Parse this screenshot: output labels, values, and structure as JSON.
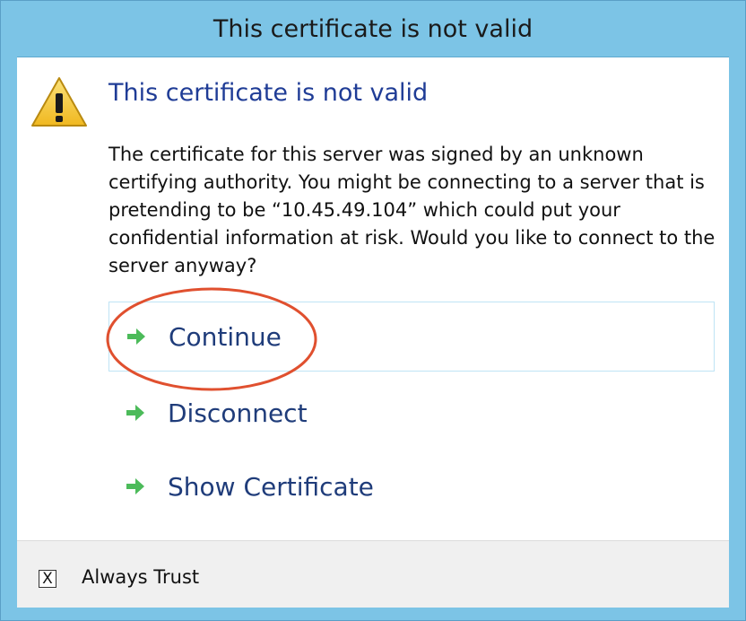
{
  "window": {
    "title": "This certificate is not valid"
  },
  "dialog": {
    "icon": "warning-triangle-icon",
    "heading": "This certificate is not valid",
    "message": "The certificate for this server was signed by an unknown certifying authority. You might be connecting to a server that is pretending to be “10.45.49.104” which could put your confidential information at risk. Would you like to connect to the server anyway?",
    "commands": [
      {
        "label": "Continue",
        "icon": "green-arrow-right-icon",
        "focused": true
      },
      {
        "label": "Disconnect",
        "icon": "green-arrow-right-icon",
        "focused": false
      },
      {
        "label": "Show Certificate",
        "icon": "green-arrow-right-icon",
        "focused": false
      }
    ],
    "annotation": {
      "type": "red-ellipse-highlight",
      "target": "Continue",
      "color": "#e0502f"
    }
  },
  "footer": {
    "checkbox": {
      "label": "Always Trust",
      "mark": "X",
      "checked": true
    }
  },
  "colors": {
    "titlebar": "#7cc4e6",
    "heading": "#1f3c96",
    "command_text": "#1f3c7a",
    "arrow": "#4cbb5a",
    "focus_border": "#bfe4f5",
    "footer_bg": "#f0f0f0"
  }
}
